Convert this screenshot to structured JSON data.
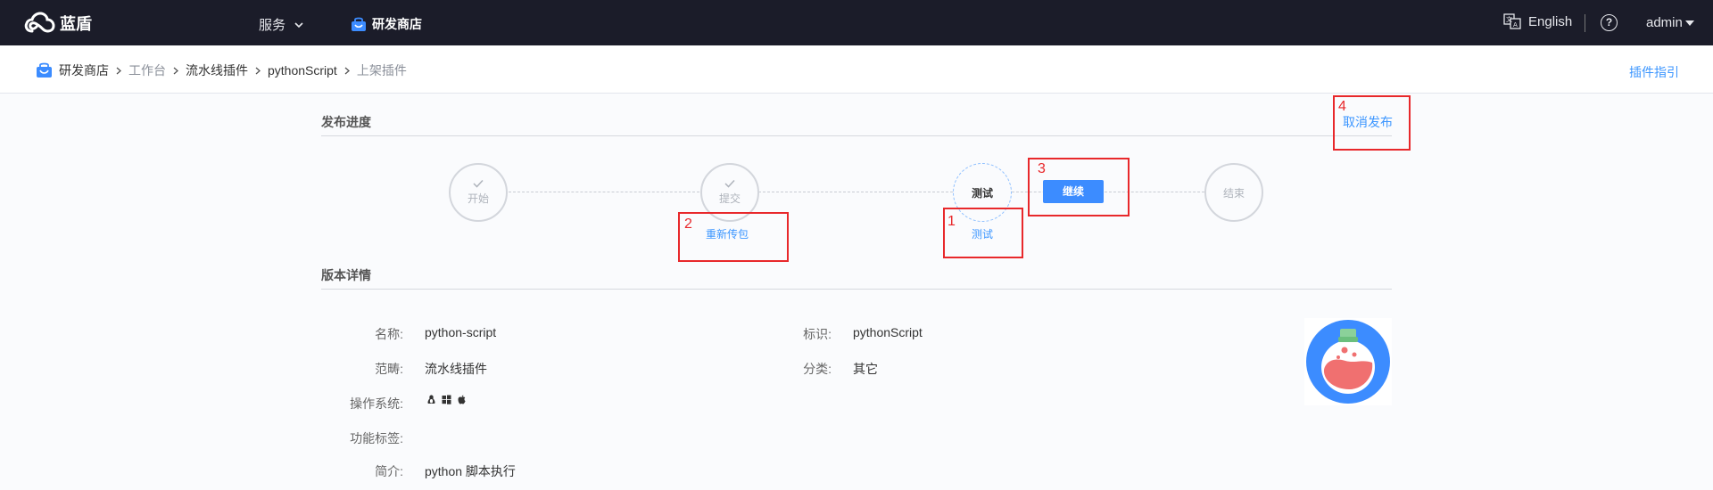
{
  "topnav": {
    "brand": "蓝盾",
    "service_menu": "服务",
    "store_link": "研发商店",
    "language": "English",
    "help": "?",
    "user": "admin"
  },
  "breadcrumb": {
    "items": [
      "研发商店",
      "工作台",
      "流水线插件",
      "pythonScript",
      "上架插件"
    ],
    "guide_link": "插件指引"
  },
  "progress": {
    "title": "发布进度",
    "cancel_label": "取消发布",
    "steps": [
      {
        "label": "开始",
        "done": true
      },
      {
        "label": "提交",
        "done": true
      },
      {
        "label": "测试",
        "done": false,
        "active": true
      },
      {
        "label": "结束",
        "done": false
      }
    ],
    "reupload_label": "重新传包",
    "test_label": "测试",
    "continue_label": "继续"
  },
  "annotations": [
    "1",
    "2",
    "3",
    "4"
  ],
  "details": {
    "title": "版本详情",
    "name_label": "名称:",
    "name_value": "python-script",
    "id_label": "标识:",
    "id_value": "pythonScript",
    "scope_label": "范畴:",
    "scope_value": "流水线插件",
    "category_label": "分类:",
    "category_value": "其它",
    "os_label": "操作系统:",
    "os_icons": [
      "linux-icon",
      "windows-icon",
      "apple-icon"
    ],
    "tags_label": "功能标签:",
    "summary_label": "简介:",
    "summary_value": "python 脚本执行"
  },
  "colors": {
    "nav_bg": "#1b1c29",
    "accent": "#3c96ff",
    "annotation": "#e8282b"
  }
}
